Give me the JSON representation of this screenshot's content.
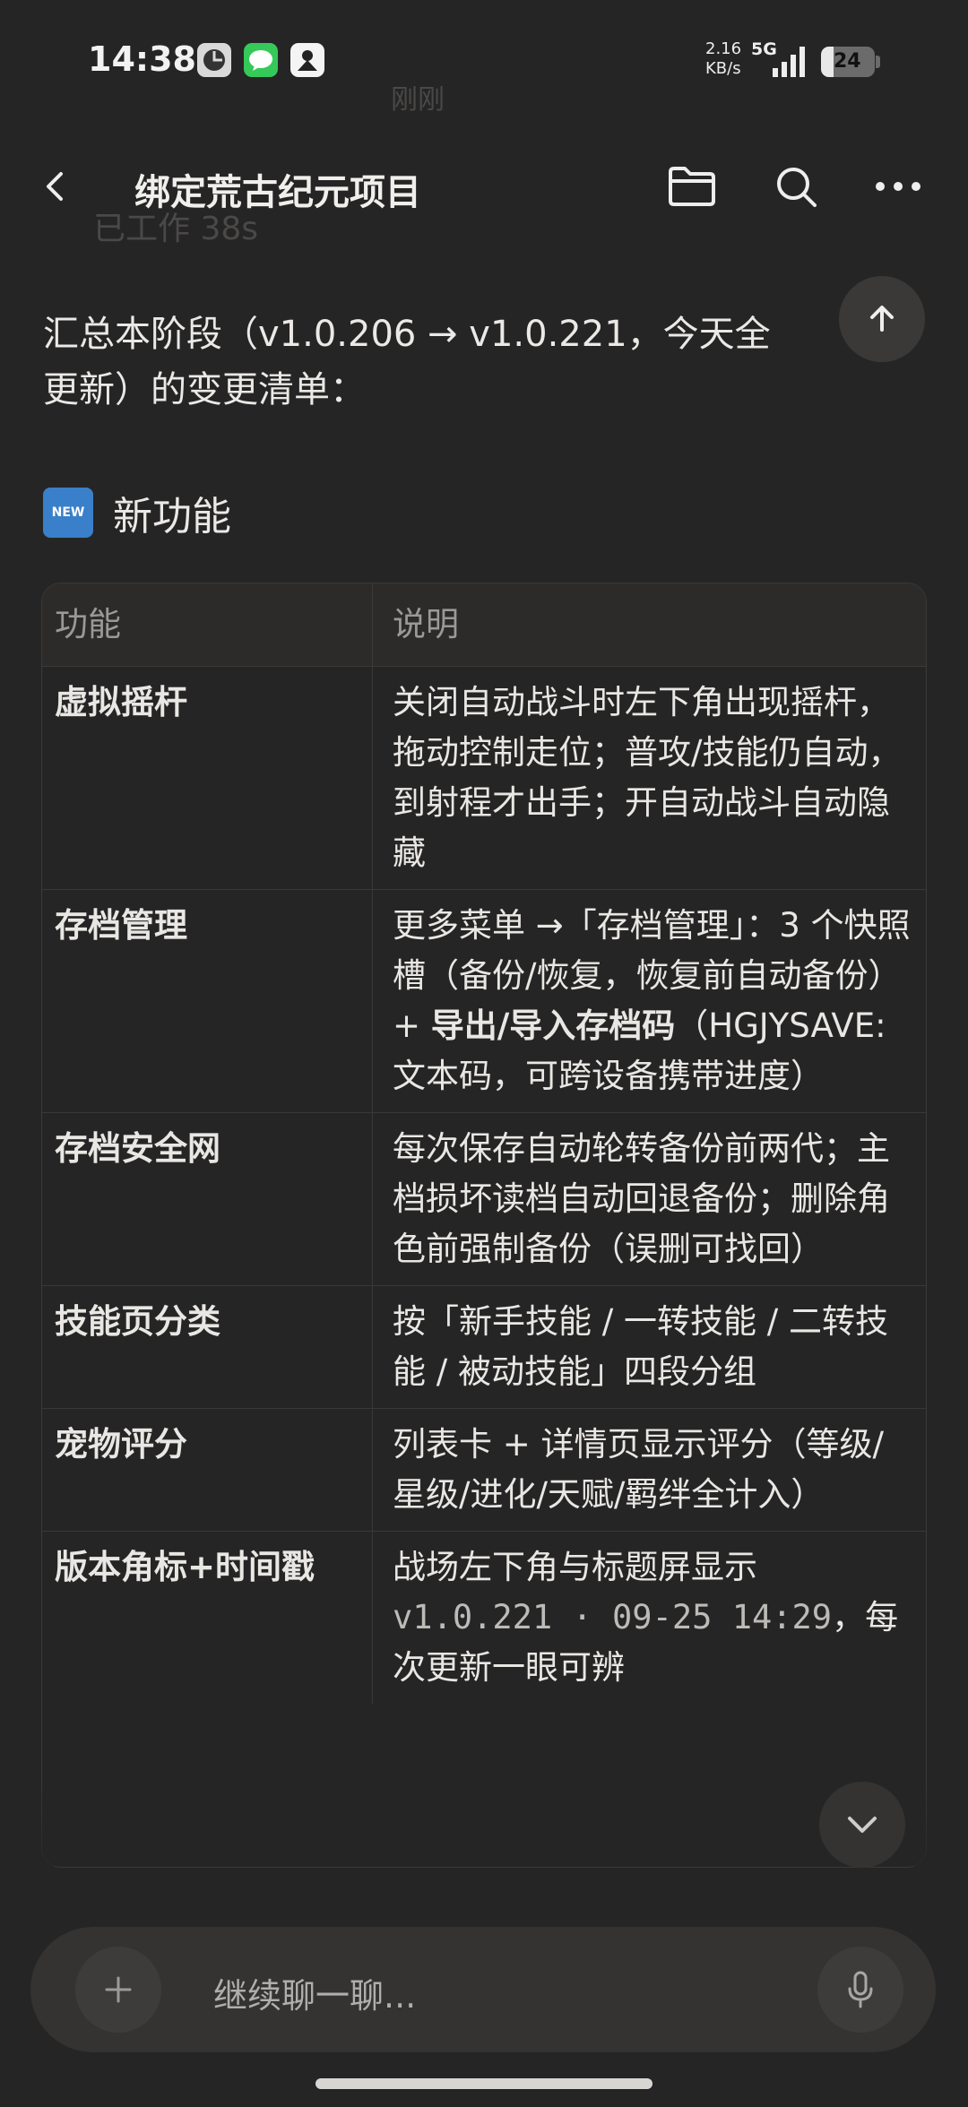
{
  "status_bar": {
    "time": "14:38",
    "net_speed_value": "2.16",
    "net_speed_unit": "KB/s",
    "network": "5G",
    "battery": "24"
  },
  "ghost": {
    "timestamp": "刚刚",
    "worked": "已工作 38s"
  },
  "header": {
    "title": "绑定荒古纪元项目",
    "icons": [
      "back-icon",
      "folder-icon",
      "search-icon",
      "more-icon"
    ]
  },
  "intro_line1": "汇总本阶段（v1.0.206 → v1.0.221，今天全",
  "intro_line2": "更新）的变更清单：",
  "section": {
    "badge": "NEW",
    "title": "新功能"
  },
  "table": {
    "headers": [
      "功能",
      "说明"
    ],
    "rows": [
      {
        "name": "虚拟摇杆",
        "desc": "关闭自动战斗时左下角出现摇杆，拖动控制走位；普攻/技能仍自动，到射程才出手；开自动战斗自动隐藏"
      },
      {
        "name": "存档管理",
        "desc_a": "更多菜单 →「存档管理」：3 个快照槽（备份/恢复，恢复前自动备份）+ ",
        "desc_bold": "导出/导入存档码",
        "desc_b": "（HGJYSAVE: 文本码，可跨设备携带进度）"
      },
      {
        "name": "存档安全网",
        "desc": "每次保存自动轮转备份前两代；主档损坏读档自动回退备份；删除角色前强制备份（误删可找回）"
      },
      {
        "name": "技能页分类",
        "desc": "按「新手技能 / 一转技能 / 二转技能 / 被动技能」四段分组"
      },
      {
        "name": "宠物评分",
        "desc": "列表卡 + 详情页显示评分（等级/星级/进化/天赋/羁绊全计入）"
      },
      {
        "name": "版本角标+时间戳",
        "desc_a": "战场左下角与标题屏显示 ",
        "desc_code": "v1.0.221 · 09-25 14:29",
        "desc_b": "，每次更新一眼可辨"
      }
    ]
  },
  "input": {
    "placeholder": "继续聊一聊..."
  }
}
